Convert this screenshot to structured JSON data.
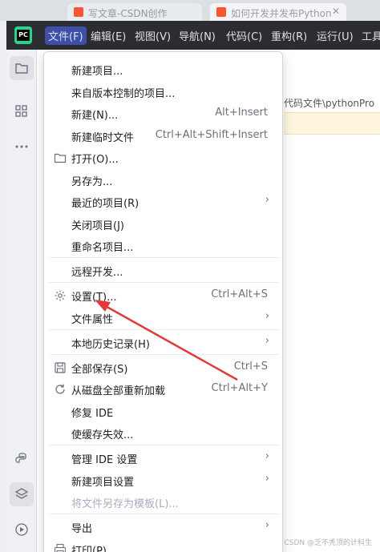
{
  "browser": {
    "tabs": [
      {
        "label": "写文章-CSDN创作",
        "active": false
      },
      {
        "label": "如何开发并发布Python",
        "active": true
      }
    ]
  },
  "menubar": {
    "items": [
      "文件(F)",
      "编辑(E)",
      "视图(V)",
      "导航(N)",
      "代码(C)",
      "重构(R)",
      "运行(U)",
      "工具"
    ],
    "open_item": "文件(F)"
  },
  "editor": {
    "path_text": "代码文件\\pythonPro"
  },
  "file_menu": {
    "items": [
      {
        "label": "新建项目...",
        "shortcut": "",
        "submenu": false,
        "icon": "",
        "disabled": false
      },
      {
        "label": "来自版本控制的项目...",
        "shortcut": "",
        "submenu": false,
        "icon": "",
        "disabled": false
      },
      {
        "label": "新建(N)...",
        "shortcut": "Alt+Insert",
        "submenu": false,
        "icon": "",
        "disabled": false
      },
      {
        "label": "新建临时文件",
        "shortcut": "Ctrl+Alt+Shift+Insert",
        "submenu": false,
        "icon": "",
        "disabled": false
      },
      {
        "label": "打开(O)...",
        "shortcut": "",
        "submenu": false,
        "icon": "folder-icon",
        "disabled": false
      },
      {
        "label": "另存为...",
        "shortcut": "",
        "submenu": false,
        "icon": "",
        "disabled": false
      },
      {
        "label": "最近的项目(R)",
        "shortcut": "",
        "submenu": true,
        "icon": "",
        "disabled": false
      },
      {
        "label": "关闭项目(J)",
        "shortcut": "",
        "submenu": false,
        "icon": "",
        "disabled": false
      },
      {
        "label": "重命名项目...",
        "shortcut": "",
        "submenu": false,
        "icon": "",
        "disabled": false
      },
      {
        "label": "远程开发...",
        "shortcut": "",
        "submenu": false,
        "icon": "",
        "disabled": false
      },
      {
        "label": "设置(T)...",
        "shortcut": "Ctrl+Alt+S",
        "submenu": false,
        "icon": "gear-icon",
        "disabled": false
      },
      {
        "label": "文件属性",
        "shortcut": "",
        "submenu": true,
        "icon": "",
        "disabled": false
      },
      {
        "label": "本地历史记录(H)",
        "shortcut": "",
        "submenu": true,
        "icon": "",
        "disabled": false
      },
      {
        "label": "全部保存(S)",
        "shortcut": "Ctrl+S",
        "submenu": false,
        "icon": "save-icon",
        "disabled": false
      },
      {
        "label": "从磁盘全部重新加载",
        "shortcut": "Ctrl+Alt+Y",
        "submenu": false,
        "icon": "reload-icon",
        "disabled": false
      },
      {
        "label": "修复 IDE",
        "shortcut": "",
        "submenu": false,
        "icon": "",
        "disabled": false
      },
      {
        "label": "使缓存失效...",
        "shortcut": "",
        "submenu": false,
        "icon": "",
        "disabled": false
      },
      {
        "label": "管理 IDE 设置",
        "shortcut": "",
        "submenu": true,
        "icon": "",
        "disabled": false
      },
      {
        "label": "新建项目设置",
        "shortcut": "",
        "submenu": true,
        "icon": "",
        "disabled": false
      },
      {
        "label": "将文件另存为模板(L)...",
        "shortcut": "",
        "submenu": false,
        "icon": "",
        "disabled": true
      },
      {
        "label": "导出",
        "shortcut": "",
        "submenu": true,
        "icon": "",
        "disabled": false
      },
      {
        "label": "打印(P)...",
        "shortcut": "",
        "submenu": false,
        "icon": "print-icon",
        "disabled": false
      }
    ],
    "submenu_glyph": "›"
  },
  "watermark": "CSDN @乏不秃顶的计科生",
  "colors": {
    "menubar_bg": "#2b2d30",
    "menu_highlight": "#3d4fa8",
    "annotation_arrow": "#e53935"
  }
}
